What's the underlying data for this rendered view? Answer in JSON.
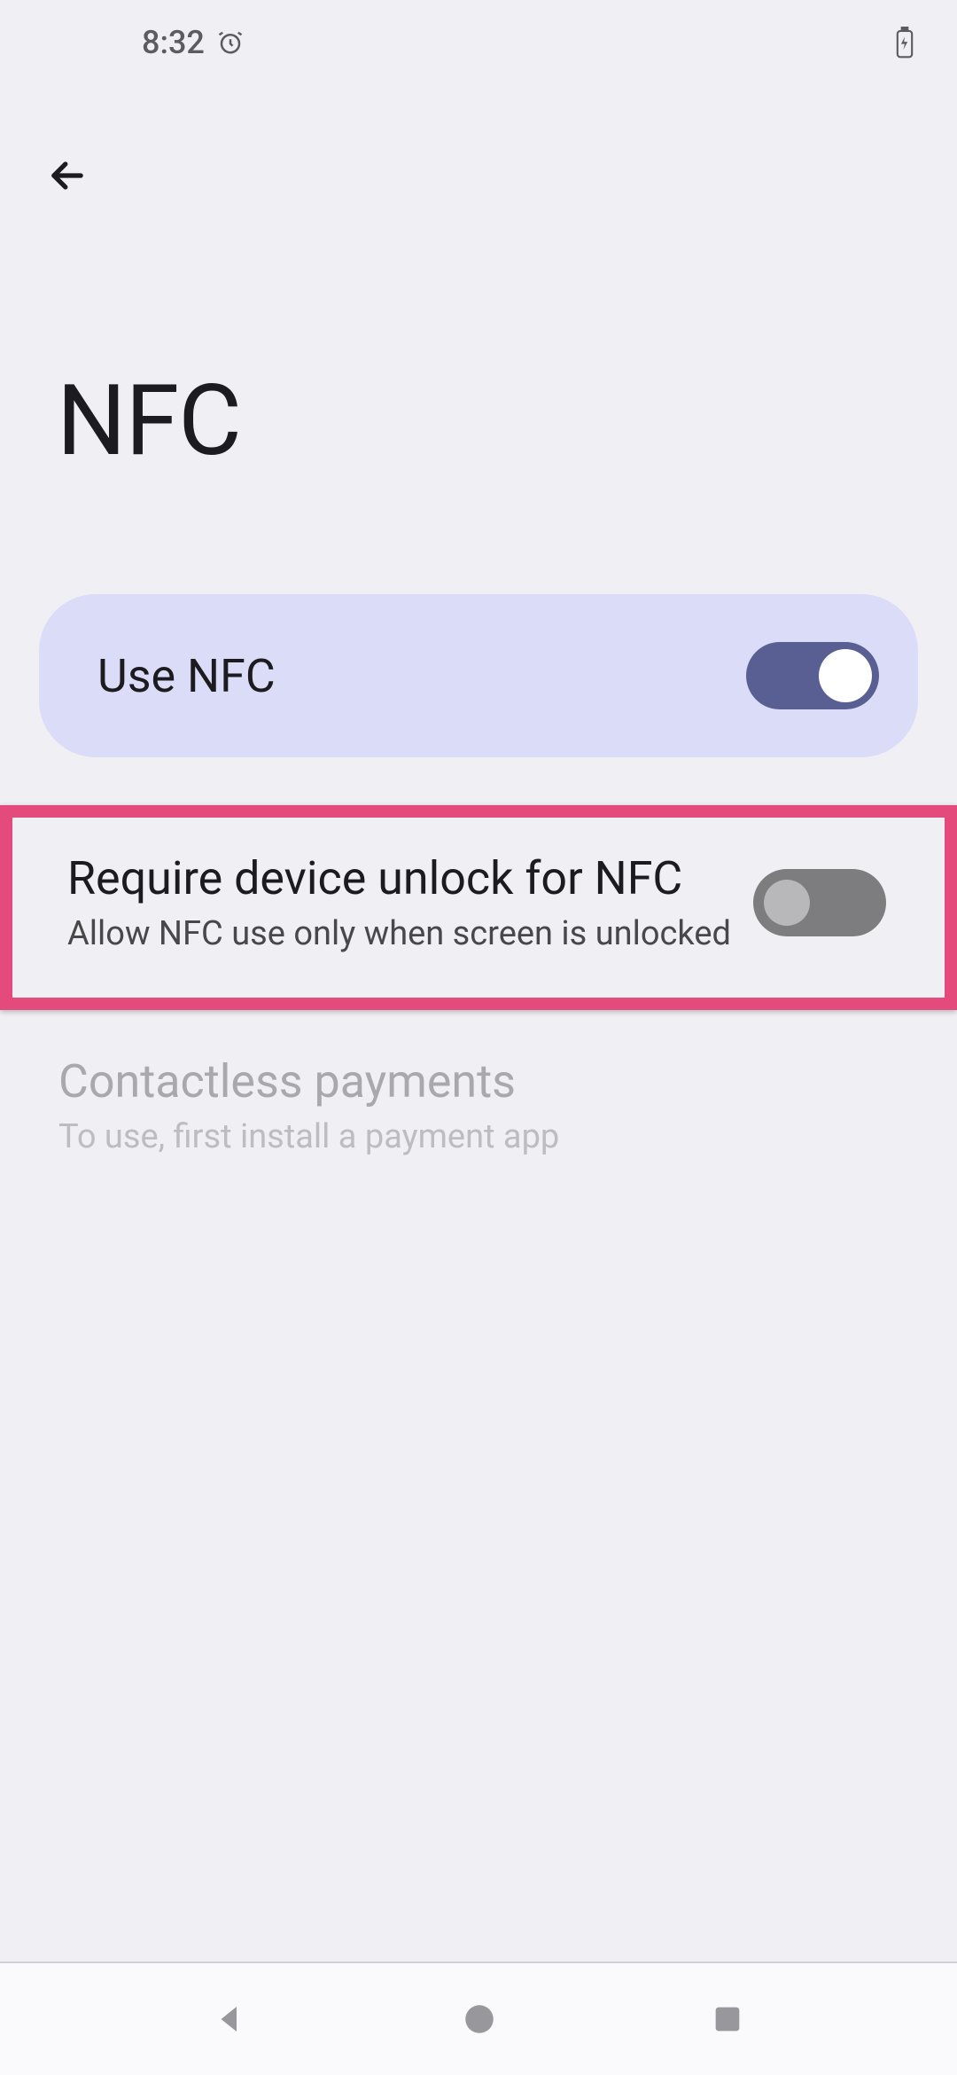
{
  "status": {
    "time": "8:32"
  },
  "header": {
    "title": "NFC"
  },
  "settings": {
    "use_nfc": {
      "label": "Use NFC",
      "enabled": true
    },
    "require_unlock": {
      "title": "Require device unlock for NFC",
      "subtitle": "Allow NFC use only when screen is unlocked",
      "enabled": false
    },
    "contactless": {
      "title": "Contactless payments",
      "subtitle": "To use, first install a payment app",
      "enabled": false
    }
  }
}
